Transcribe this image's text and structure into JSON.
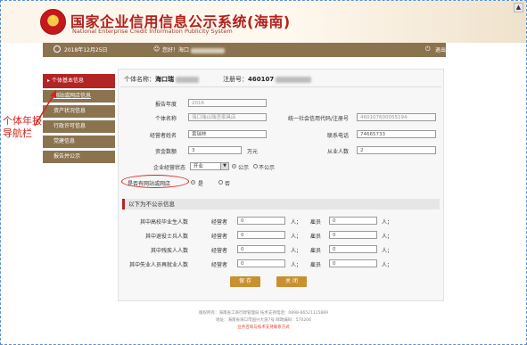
{
  "header": {
    "title": "国家企业信用信息公示系统(海南)",
    "subtitle": "National Enterprise Credit Information Publicity System"
  },
  "topbar": {
    "date": "2018年12月25日",
    "user_prefix": "您好！海口",
    "logout": "退出登录"
  },
  "sidebar": {
    "items": [
      {
        "label": "个体基本信息",
        "active": true
      },
      {
        "label": "网站或网店信息",
        "active": false
      },
      {
        "label": "资产状况信息",
        "active": false
      },
      {
        "label": "行政许可信息",
        "active": false
      },
      {
        "label": "党建信息",
        "active": false
      },
      {
        "label": "报告并公示",
        "active": false
      }
    ]
  },
  "annotation": {
    "text": "个体年报导航栏"
  },
  "info": {
    "name_label": "个体名称：",
    "name_value": "海口瑞",
    "reg_label": "注册号：",
    "reg_value": "460107"
  },
  "form": {
    "year_label": "报告年度",
    "year_value": "2016",
    "name_label": "个体名称",
    "name_value": "海口瑞山瑞丞家具店",
    "credit_label": "统一社会信用代码/注册号",
    "credit_value": "460107600055194",
    "operator_label": "经营者姓名",
    "operator_value": "黄瑞林",
    "phone_label": "联系电话",
    "phone_value": "74665733",
    "capital_label": "资金数额",
    "capital_value": "3",
    "capital_unit": "万元",
    "staff_label": "从业人数",
    "staff_value": "2",
    "status_label": "企业经营状态",
    "status_value": "开业",
    "publish_option": "公示",
    "nopublish_option": "不公示",
    "website_label": "是否有网站或网店",
    "yes": "是",
    "no": "否"
  },
  "private_section": {
    "title": "以下为不公示信息",
    "operator_label": "经营者",
    "employee_label": "雇员",
    "rows": [
      {
        "label": "其中高校毕业生人数",
        "operator": "0",
        "employee": "0"
      },
      {
        "label": "其中退役士兵人数",
        "operator": "0",
        "employee": "0"
      },
      {
        "label": "其中残疾人人数",
        "operator": "0",
        "employee": "0"
      },
      {
        "label": "其中失业人员再就业人数",
        "operator": "0",
        "employee": "0"
      }
    ]
  },
  "buttons": {
    "save": "保 存",
    "close": "关 闭"
  },
  "footer": {
    "line1": "版权所有：海南省工商行政管理局 技术支持电话：0898-66521115889",
    "line2": "地址：海南省海口市国兴大道7号 邮政编码：570206",
    "line3": "业务咨询与技术支持联系方式"
  }
}
